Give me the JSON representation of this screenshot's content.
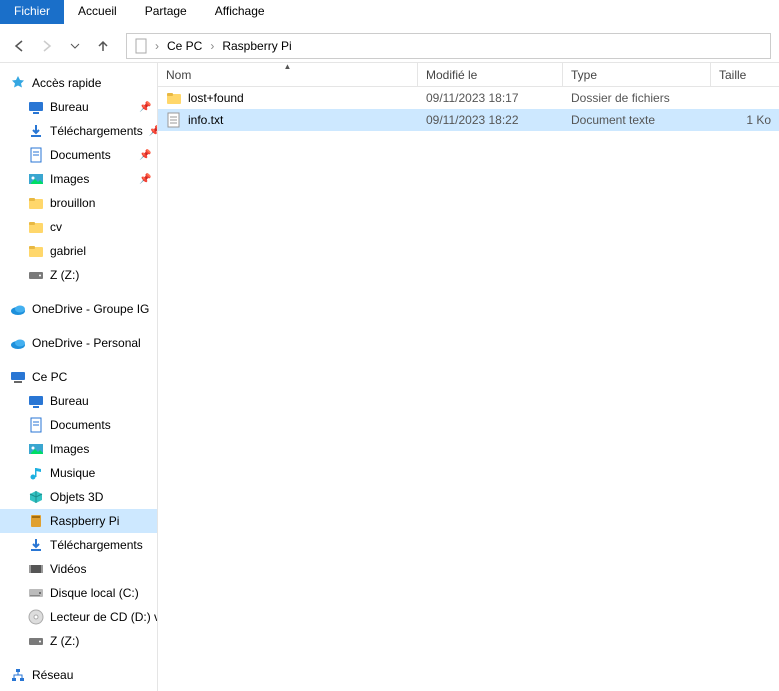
{
  "menu": {
    "items": [
      "Fichier",
      "Accueil",
      "Partage",
      "Affichage"
    ],
    "active_index": 0
  },
  "nav": {
    "segments": [
      "Ce PC",
      "Raspberry Pi"
    ]
  },
  "sidebar": {
    "quick_access": "Accès rapide",
    "quick_items": [
      {
        "label": "Bureau",
        "icon": "desktop",
        "pinned": true
      },
      {
        "label": "Téléchargements",
        "icon": "download",
        "pinned": true
      },
      {
        "label": "Documents",
        "icon": "document",
        "pinned": true
      },
      {
        "label": "Images",
        "icon": "picture",
        "pinned": true
      },
      {
        "label": "brouillon",
        "icon": "folder",
        "pinned": false
      },
      {
        "label": "cv",
        "icon": "folder",
        "pinned": false
      },
      {
        "label": "gabriel",
        "icon": "folder",
        "pinned": false
      },
      {
        "label": "Z (Z:)",
        "icon": "drive",
        "pinned": false
      }
    ],
    "onedrive_group": "OneDrive - Groupe IG",
    "onedrive_personal": "OneDrive - Personal",
    "this_pc": "Ce PC",
    "pc_items": [
      {
        "label": "Bureau",
        "icon": "desktop"
      },
      {
        "label": "Documents",
        "icon": "document"
      },
      {
        "label": "Images",
        "icon": "picture"
      },
      {
        "label": "Musique",
        "icon": "music"
      },
      {
        "label": "Objets 3D",
        "icon": "objects3d"
      },
      {
        "label": "Raspberry Pi",
        "icon": "sd",
        "selected": true
      },
      {
        "label": "Téléchargements",
        "icon": "download"
      },
      {
        "label": "Vidéos",
        "icon": "video"
      },
      {
        "label": "Disque local (C:)",
        "icon": "hdd"
      },
      {
        "label": "Lecteur de CD (D:) v",
        "icon": "cd"
      },
      {
        "label": "Z (Z:)",
        "icon": "drive"
      }
    ],
    "network": "Réseau"
  },
  "columns": {
    "name": "Nom",
    "date": "Modifié le",
    "type": "Type",
    "size": "Taille"
  },
  "rows": [
    {
      "name": "lost+found",
      "icon": "folder",
      "date": "09/11/2023 18:17",
      "type": "Dossier de fichiers",
      "size": ""
    },
    {
      "name": "info.txt",
      "icon": "txt",
      "date": "09/11/2023 18:22",
      "type": "Document texte",
      "size": "1 Ko",
      "selected": true
    }
  ]
}
